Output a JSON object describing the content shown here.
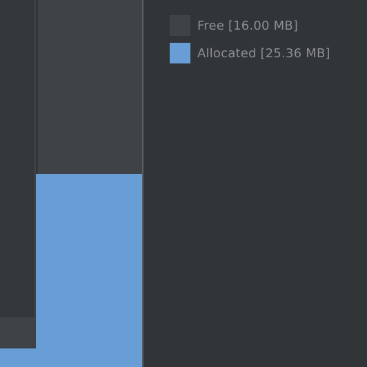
{
  "colors": {
    "background": "#323538",
    "free": "#3f4347",
    "allocated": "#689dd5",
    "legend_text": "#8b8e92",
    "divider": "#5a5d61"
  },
  "legend": {
    "items": [
      {
        "label": "Free [16.00 MB]",
        "color": "#3f4347"
      },
      {
        "label": "Allocated [25.36 MB]",
        "color": "#689dd5"
      }
    ]
  },
  "chart_data": {
    "type": "area",
    "legend_placement": "top-right",
    "series": [
      {
        "name": "Free",
        "values_mb": [
          16.0
        ],
        "color": "#3f4347"
      },
      {
        "name": "Allocated",
        "values_mb": [
          25.36
        ],
        "color": "#689dd5"
      }
    ]
  }
}
